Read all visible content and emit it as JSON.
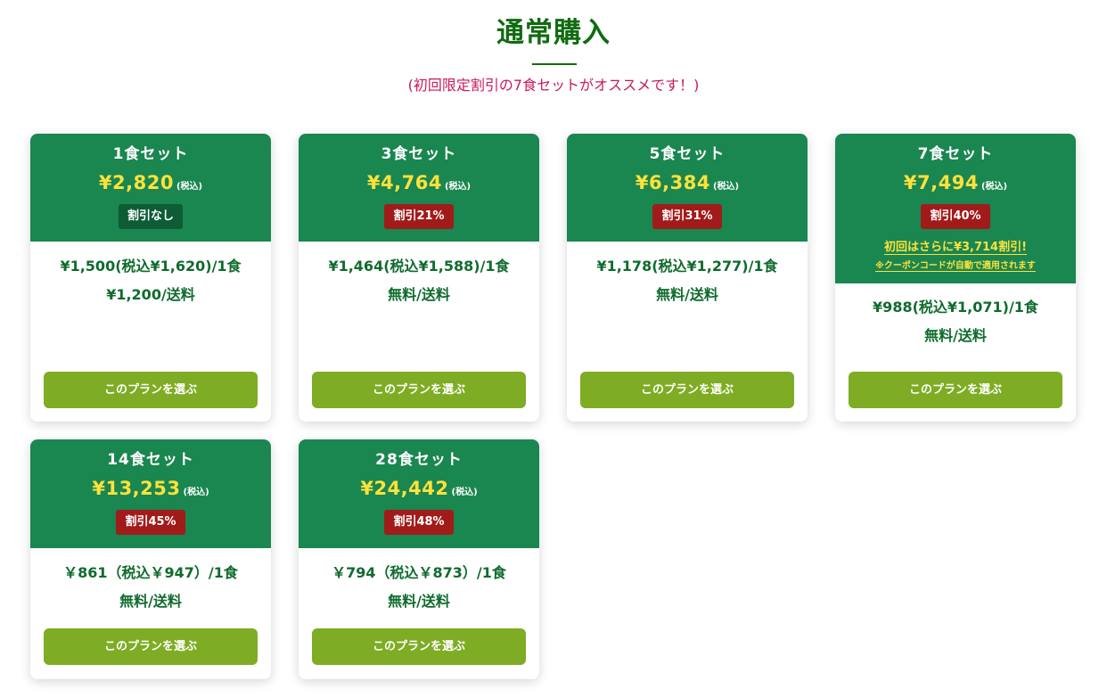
{
  "header": {
    "title": "通常購入",
    "subtitle": "(初回限定割引の7食セットがオススメです！)"
  },
  "colors": {
    "title": "#106b10",
    "subtitle": "#c8195e",
    "card_header": "#1a8650",
    "price": "#ffe13a",
    "discount_badge": "#a11b1b",
    "no_discount_badge": "#0d5c36",
    "button": "#7eac24",
    "body_text": "#0f6b2d"
  },
  "plans": [
    {
      "name": "1食セット",
      "price": "¥2,820",
      "tax_note": "(税込)",
      "badge": "割引なし",
      "per_meal": "¥1,500(税込¥1,620)/1食",
      "shipping": "¥1,200/送料",
      "button": "このプランを選ぶ"
    },
    {
      "name": "3食セット",
      "price": "¥4,764",
      "tax_note": "(税込)",
      "badge": "割引21%",
      "per_meal": "¥1,464(税込¥1,588)/1食",
      "shipping": "無料/送料",
      "button": "このプランを選ぶ"
    },
    {
      "name": "5食セット",
      "price": "¥6,384",
      "tax_note": "(税込)",
      "badge": "割引31%",
      "per_meal": "¥1,178(税込¥1,277)/1食",
      "shipping": "無料/送料",
      "button": "このプランを選ぶ"
    },
    {
      "name": "7食セット",
      "price": "¥7,494",
      "tax_note": "(税込)",
      "badge": "割引40%",
      "first_time": "初回はさらに¥3,714割引!",
      "coupon_note": "※クーポンコードが自動で適用されます",
      "per_meal": "¥988(税込¥1,071)/1食",
      "shipping": "無料/送料",
      "button": "このプランを選ぶ"
    },
    {
      "name": "14食セット",
      "price": "¥13,253",
      "tax_note": "(税込)",
      "badge": "割引45%",
      "per_meal": "￥861（税込￥947）/1食",
      "shipping": "無料/送料",
      "button": "このプランを選ぶ"
    },
    {
      "name": "28食セット",
      "price": "¥24,442",
      "tax_note": "(税込)",
      "badge": "割引48%",
      "per_meal": "￥794（税込￥873）/1食",
      "shipping": "無料/送料",
      "button": "このプランを選ぶ"
    }
  ]
}
